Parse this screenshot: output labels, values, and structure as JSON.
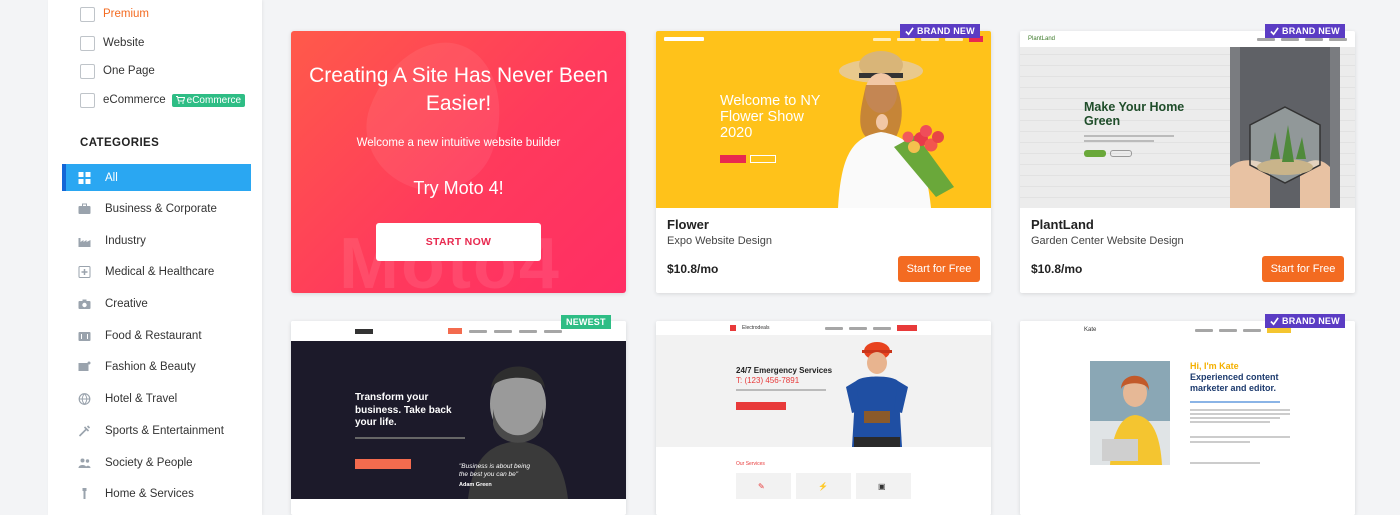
{
  "filters": {
    "premium": "Premium",
    "website": "Website",
    "one_page": "One Page",
    "ecommerce": "eCommerce",
    "ecommerce_badge": "eCommerce"
  },
  "categories": {
    "heading": "CATEGORIES",
    "items": [
      {
        "label": "All",
        "icon": "grid-icon"
      },
      {
        "label": "Business & Corporate",
        "icon": "briefcase-icon"
      },
      {
        "label": "Industry",
        "icon": "factory-icon"
      },
      {
        "label": "Medical & Healthcare",
        "icon": "medical-icon"
      },
      {
        "label": "Creative",
        "icon": "camera-icon"
      },
      {
        "label": "Food & Restaurant",
        "icon": "food-icon"
      },
      {
        "label": "Fashion & Beauty",
        "icon": "fashion-icon"
      },
      {
        "label": "Hotel & Travel",
        "icon": "globe-icon"
      },
      {
        "label": "Sports & Entertainment",
        "icon": "sports-icon"
      },
      {
        "label": "Society & People",
        "icon": "people-icon"
      },
      {
        "label": "Home & Services",
        "icon": "home-icon"
      }
    ]
  },
  "promo": {
    "title": "Creating A Site Has Never Been Easier!",
    "subtitle": "Welcome a new intuitive website builder",
    "try": "Try Moto 4!",
    "button": "START NOW",
    "bg_word": "Moto4"
  },
  "cards": [
    {
      "title": "Flower",
      "subtitle": "Expo Website Design",
      "price": "$10.8/mo",
      "cta": "Start for Free",
      "badge": "BRAND NEW",
      "thumb_headline": "Welcome to NY Flower Show 2020"
    },
    {
      "title": "PlantLand",
      "subtitle": "Garden Center Website Design",
      "price": "$10.8/mo",
      "cta": "Start for Free",
      "badge": "BRAND NEW",
      "thumb_headline": "Make Your Home Green",
      "thumb_logo": "PlantLand"
    },
    {
      "badge": "NEWEST",
      "thumb_headline": "Transform your business. Take back your life.",
      "thumb_quote": "\"Business is about being the best you can be\"",
      "thumb_person": "Adam Green"
    },
    {
      "thumb_logo": "Electrodeals",
      "thumb_headline": "24/7 Emergency Services",
      "thumb_phone": "T: (123) 456-7891",
      "thumb_section": "Our Services"
    },
    {
      "badge": "BRAND NEW",
      "thumb_logo": "Kate",
      "thumb_greeting": "Hi, I'm Kate",
      "thumb_headline": "Experienced content marketer and editor."
    }
  ],
  "colors": {
    "accent": "#f36b21",
    "active_category": "#2aa7f2",
    "brand_badge": "#5b3cc4",
    "newest_badge": "#2ebd85"
  }
}
